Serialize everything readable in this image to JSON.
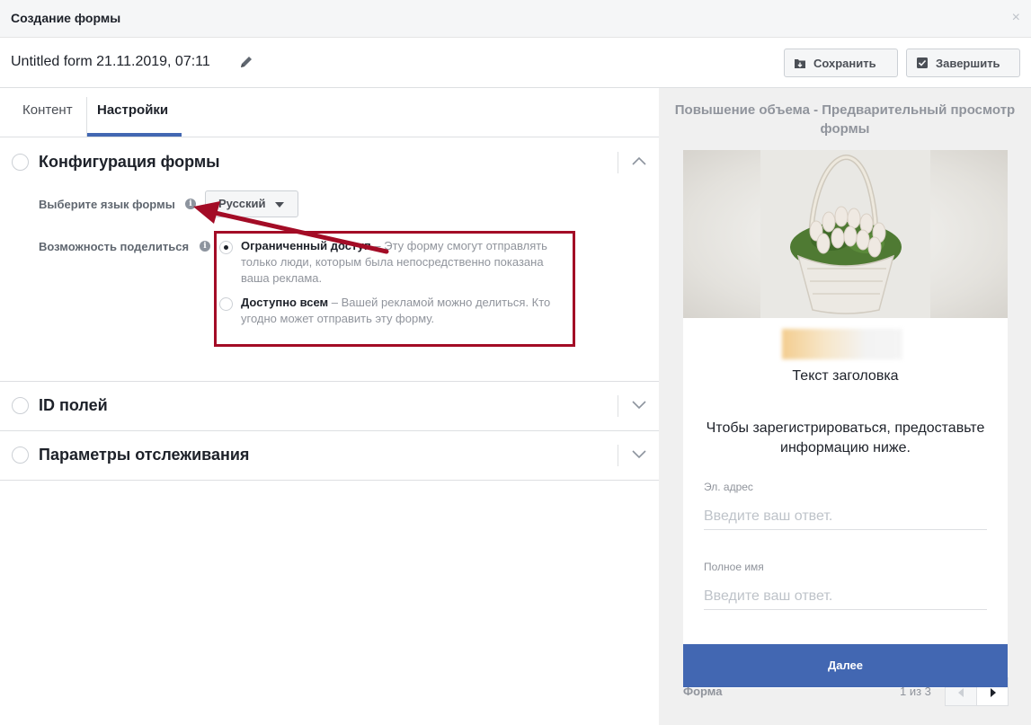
{
  "dialog": {
    "title": "Создание формы",
    "close_glyph": "×"
  },
  "form": {
    "name": "Untitled form 21.11.2019, 07:11"
  },
  "toolbar": {
    "save_label": "Сохранить",
    "finish_label": "Завершить"
  },
  "tabs": [
    {
      "label": "Контент",
      "active": false
    },
    {
      "label": "Настройки",
      "active": true
    }
  ],
  "sections": {
    "config": {
      "title": "Конфигурация формы",
      "expanded": true
    },
    "field_ids": {
      "title": "ID полей",
      "expanded": false
    },
    "tracking": {
      "title": "Параметры отслеживания",
      "expanded": false
    }
  },
  "language": {
    "label": "Выберите язык формы",
    "value": "Русский"
  },
  "sharing": {
    "label": "Возможность поделиться",
    "options": [
      {
        "title": "Ограниченный доступ",
        "description": " – Эту форму смогут отправлять только люди, которым была непосредственно показана ваша реклама.",
        "selected": true
      },
      {
        "title": "Доступно всем",
        "description": " – Вашей рекламой можно делиться. Кто угодно может отправить эту форму.",
        "selected": false
      }
    ]
  },
  "preview": {
    "title": "Повышение объема - Предварительный просмотр формы",
    "headline": "Текст заголовка",
    "intro": "Чтобы зарегистрироваться, предоставьте информацию ниже.",
    "fields": [
      {
        "label": "Эл. адрес",
        "placeholder": "Введите ваш ответ."
      },
      {
        "label": "Полное имя",
        "placeholder": "Введите ваш ответ."
      }
    ],
    "next_label": "Далее",
    "footer_label": "Форма",
    "pager": "1 из 3"
  },
  "colors": {
    "accent": "#4267b2",
    "highlight_box": "#a30c26",
    "annotation_arrow": "#a30c26"
  },
  "icons": [
    "close-icon",
    "pencil-icon",
    "save-icon",
    "finish-icon",
    "info-icon",
    "chevron-up-icon",
    "chevron-down-icon",
    "caret-down-icon",
    "prev-icon",
    "next-icon"
  ]
}
